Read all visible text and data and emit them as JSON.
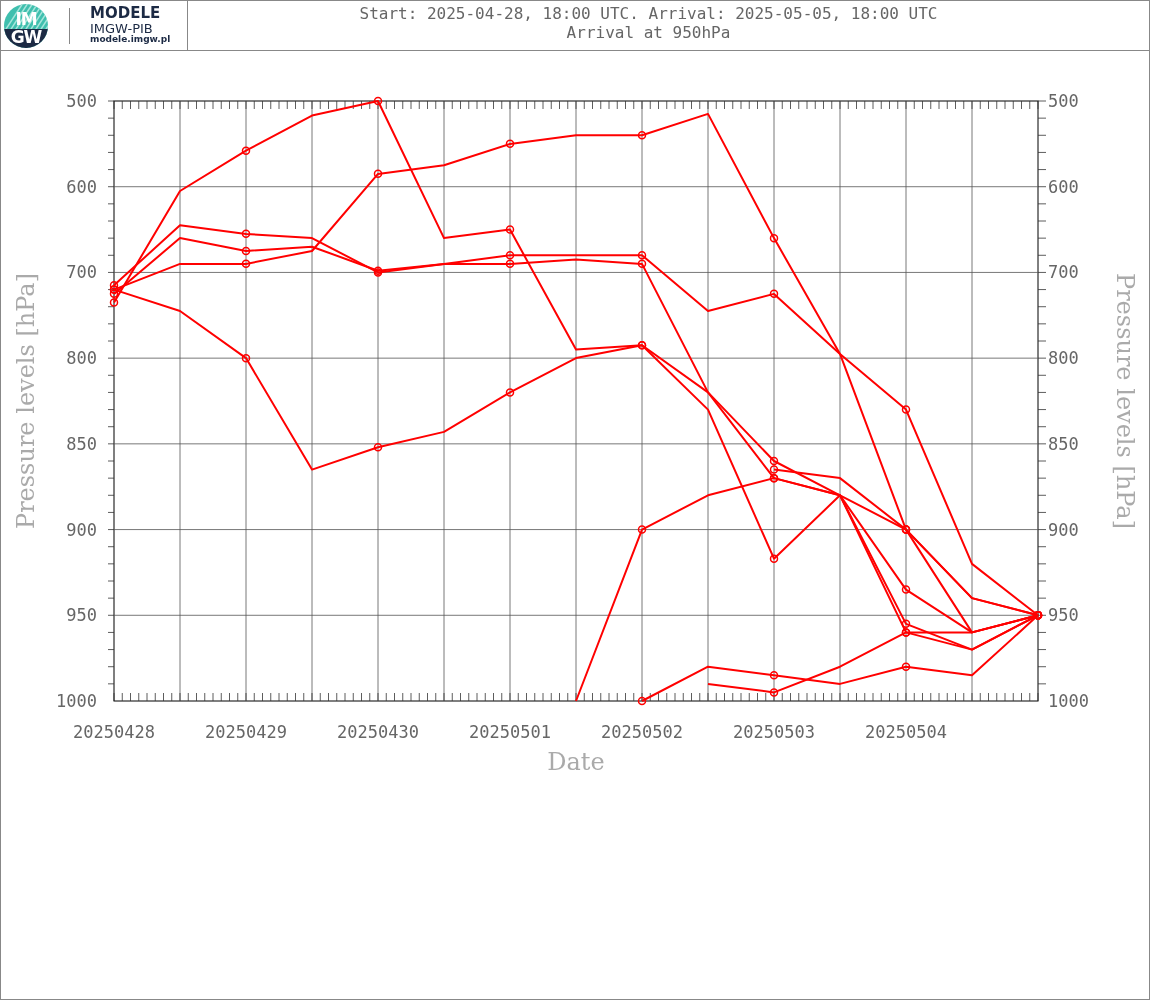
{
  "header": {
    "logo_text": [
      "IM",
      "GW"
    ],
    "brand": "MODELE",
    "organization": "IMGW-PIB",
    "website": "modele.imgw.pl",
    "title_lines": [
      "Start: 2025-04-28, 18:00 UTC. Arrival: 2025-05-05, 18:00 UTC",
      "Arrival at 950hPa"
    ]
  },
  "chart": {
    "x_axis": {
      "label": "Date",
      "ticks": [
        "20250428",
        "20250429",
        "20250430",
        "20250501",
        "20250502",
        "20250503",
        "20250504"
      ]
    },
    "left_axis": {
      "label": "Pressure levels [hPa]",
      "ticks": [
        "500",
        "600",
        "700",
        "800",
        "850",
        "900",
        "950",
        "1000"
      ]
    },
    "right_axis": {
      "label": "Pressure levels [hPa]",
      "ticks": [
        "500",
        "600",
        "700",
        "800",
        "850",
        "900",
        "950",
        "1000"
      ]
    }
  }
}
